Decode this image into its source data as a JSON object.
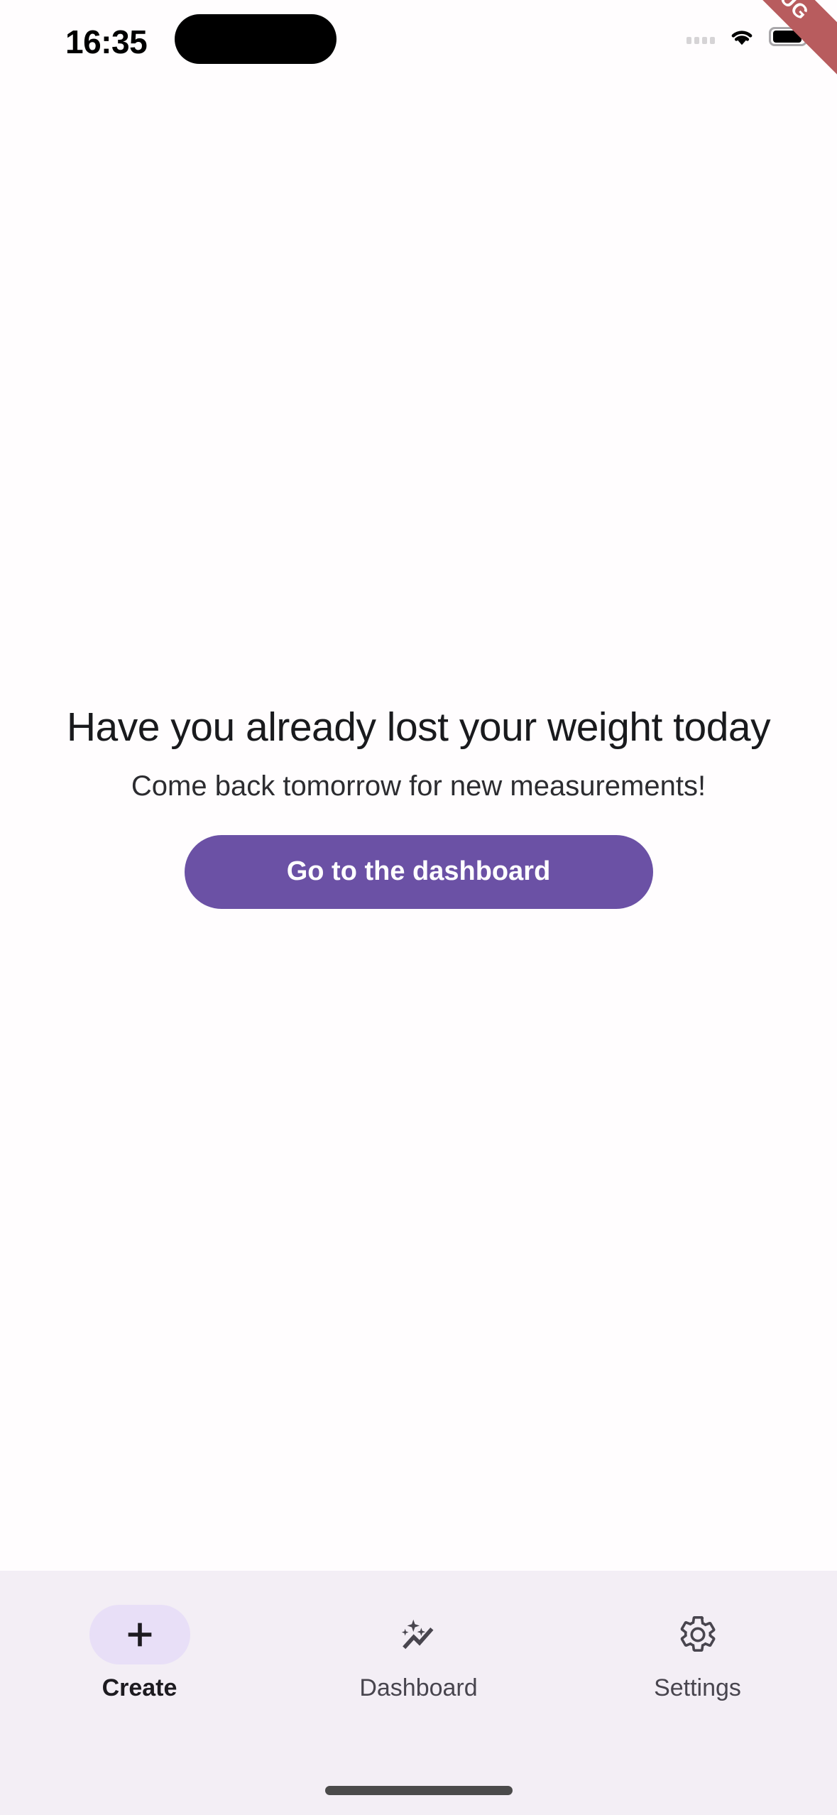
{
  "status_bar": {
    "time": "16:35",
    "signal_icon": "signal-dots-icon",
    "wifi_icon": "wifi-icon",
    "battery_icon": "battery-icon"
  },
  "debug_banner": {
    "label": "DEBUG",
    "color": "#b85c5e"
  },
  "main": {
    "headline": "Have you already lost your weight today",
    "subhead": "Come back tomorrow for new measurements!",
    "cta_label": "Go to the dashboard",
    "cta_color": "#6b51a5"
  },
  "bottom_nav": {
    "background": "#f3eef5",
    "active_pill_color": "#e8dff7",
    "items": [
      {
        "label": "Create",
        "icon": "plus-icon",
        "active": true
      },
      {
        "label": "Dashboard",
        "icon": "auto-graph-icon",
        "active": false
      },
      {
        "label": "Settings",
        "icon": "gear-icon",
        "active": false
      }
    ]
  },
  "home_indicator": {
    "name": "home-indicator"
  }
}
